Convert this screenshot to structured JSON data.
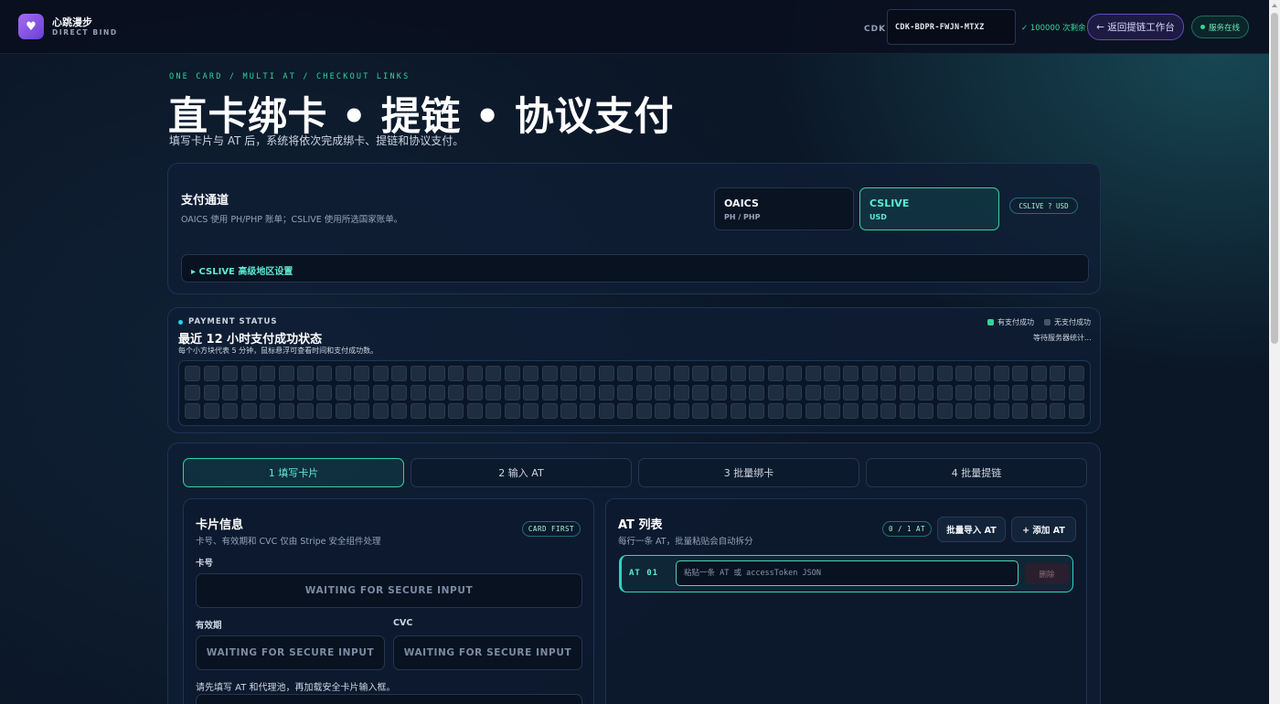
{
  "header": {
    "app_name": "心跳漫步",
    "app_subtitle": "DIRECT BIND",
    "logo_icon": "heart-icon",
    "cdk_label": "CDK",
    "cdk_value": "CDK-BDPR-FWJN-MTXZ",
    "cdk_remaining": "✓ 100000 次剩余",
    "back_button": "← 返回提链工作台",
    "status_text": "服务在线"
  },
  "hero": {
    "kicker": "ONE CARD / MULTI AT / CHECKOUT LINKS",
    "title": "直卡绑卡 • 提链 • 协议支付",
    "subtitle": "填写卡片与 AT 后，系统将依次完成绑卡、提链和协议支付。"
  },
  "payment_channel": {
    "title": "支付通道",
    "description": "OAICS 使用 PH/PHP 账单；CSLIVE 使用所选国家账单。",
    "options": [
      {
        "name": "OAICS",
        "sub": "PH / PHP",
        "selected": false
      },
      {
        "name": "CSLIVE",
        "sub": "USD",
        "selected": true
      }
    ],
    "tag": "CSLIVE ? USD",
    "advanced_label": "▸ CSLIVE 高级地区设置"
  },
  "payment_status": {
    "kicker": "PAYMENT STATUS",
    "title": "最近 12 小时支付成功状态",
    "description": "每个小方块代表 5 分钟，鼠标悬浮可查看时间和支付成功数。",
    "legend_success": "有支付成功",
    "legend_none": "无支付成功",
    "waiting_text": "等待服务器统计...",
    "colors": {
      "success": "#34d399",
      "none": "#475569",
      "empty_cell": "#1f2d40"
    },
    "cells_count": 144
  },
  "steps": [
    {
      "label": "1 填写卡片",
      "active": true
    },
    {
      "label": "2 输入 AT",
      "active": false
    },
    {
      "label": "3 批量绑卡",
      "active": false
    },
    {
      "label": "4 批量提链",
      "active": false
    }
  ],
  "card_info": {
    "title": "卡片信息",
    "description": "卡号、有效期和 CVC 仅由 Stripe 安全组件处理",
    "chip": "CARD FIRST",
    "card_number_label": "卡号",
    "expiry_label": "有效期",
    "cvc_label": "CVC",
    "secure_placeholder": "WAITING FOR SECURE INPUT",
    "hint": "请先填写 AT 和代理池，再加载安全卡片输入框。"
  },
  "at_list": {
    "title": "AT 列表",
    "description": "每行一条 AT，批量粘贴会自动拆分",
    "count_chip": "0 / 1 AT",
    "import_button": "批量导入 AT",
    "add_button": "+ 添加 AT",
    "rows": [
      {
        "label": "AT 01",
        "placeholder": "粘贴一条 AT 或 accessToken JSON",
        "delete_label": "删除"
      }
    ]
  }
}
